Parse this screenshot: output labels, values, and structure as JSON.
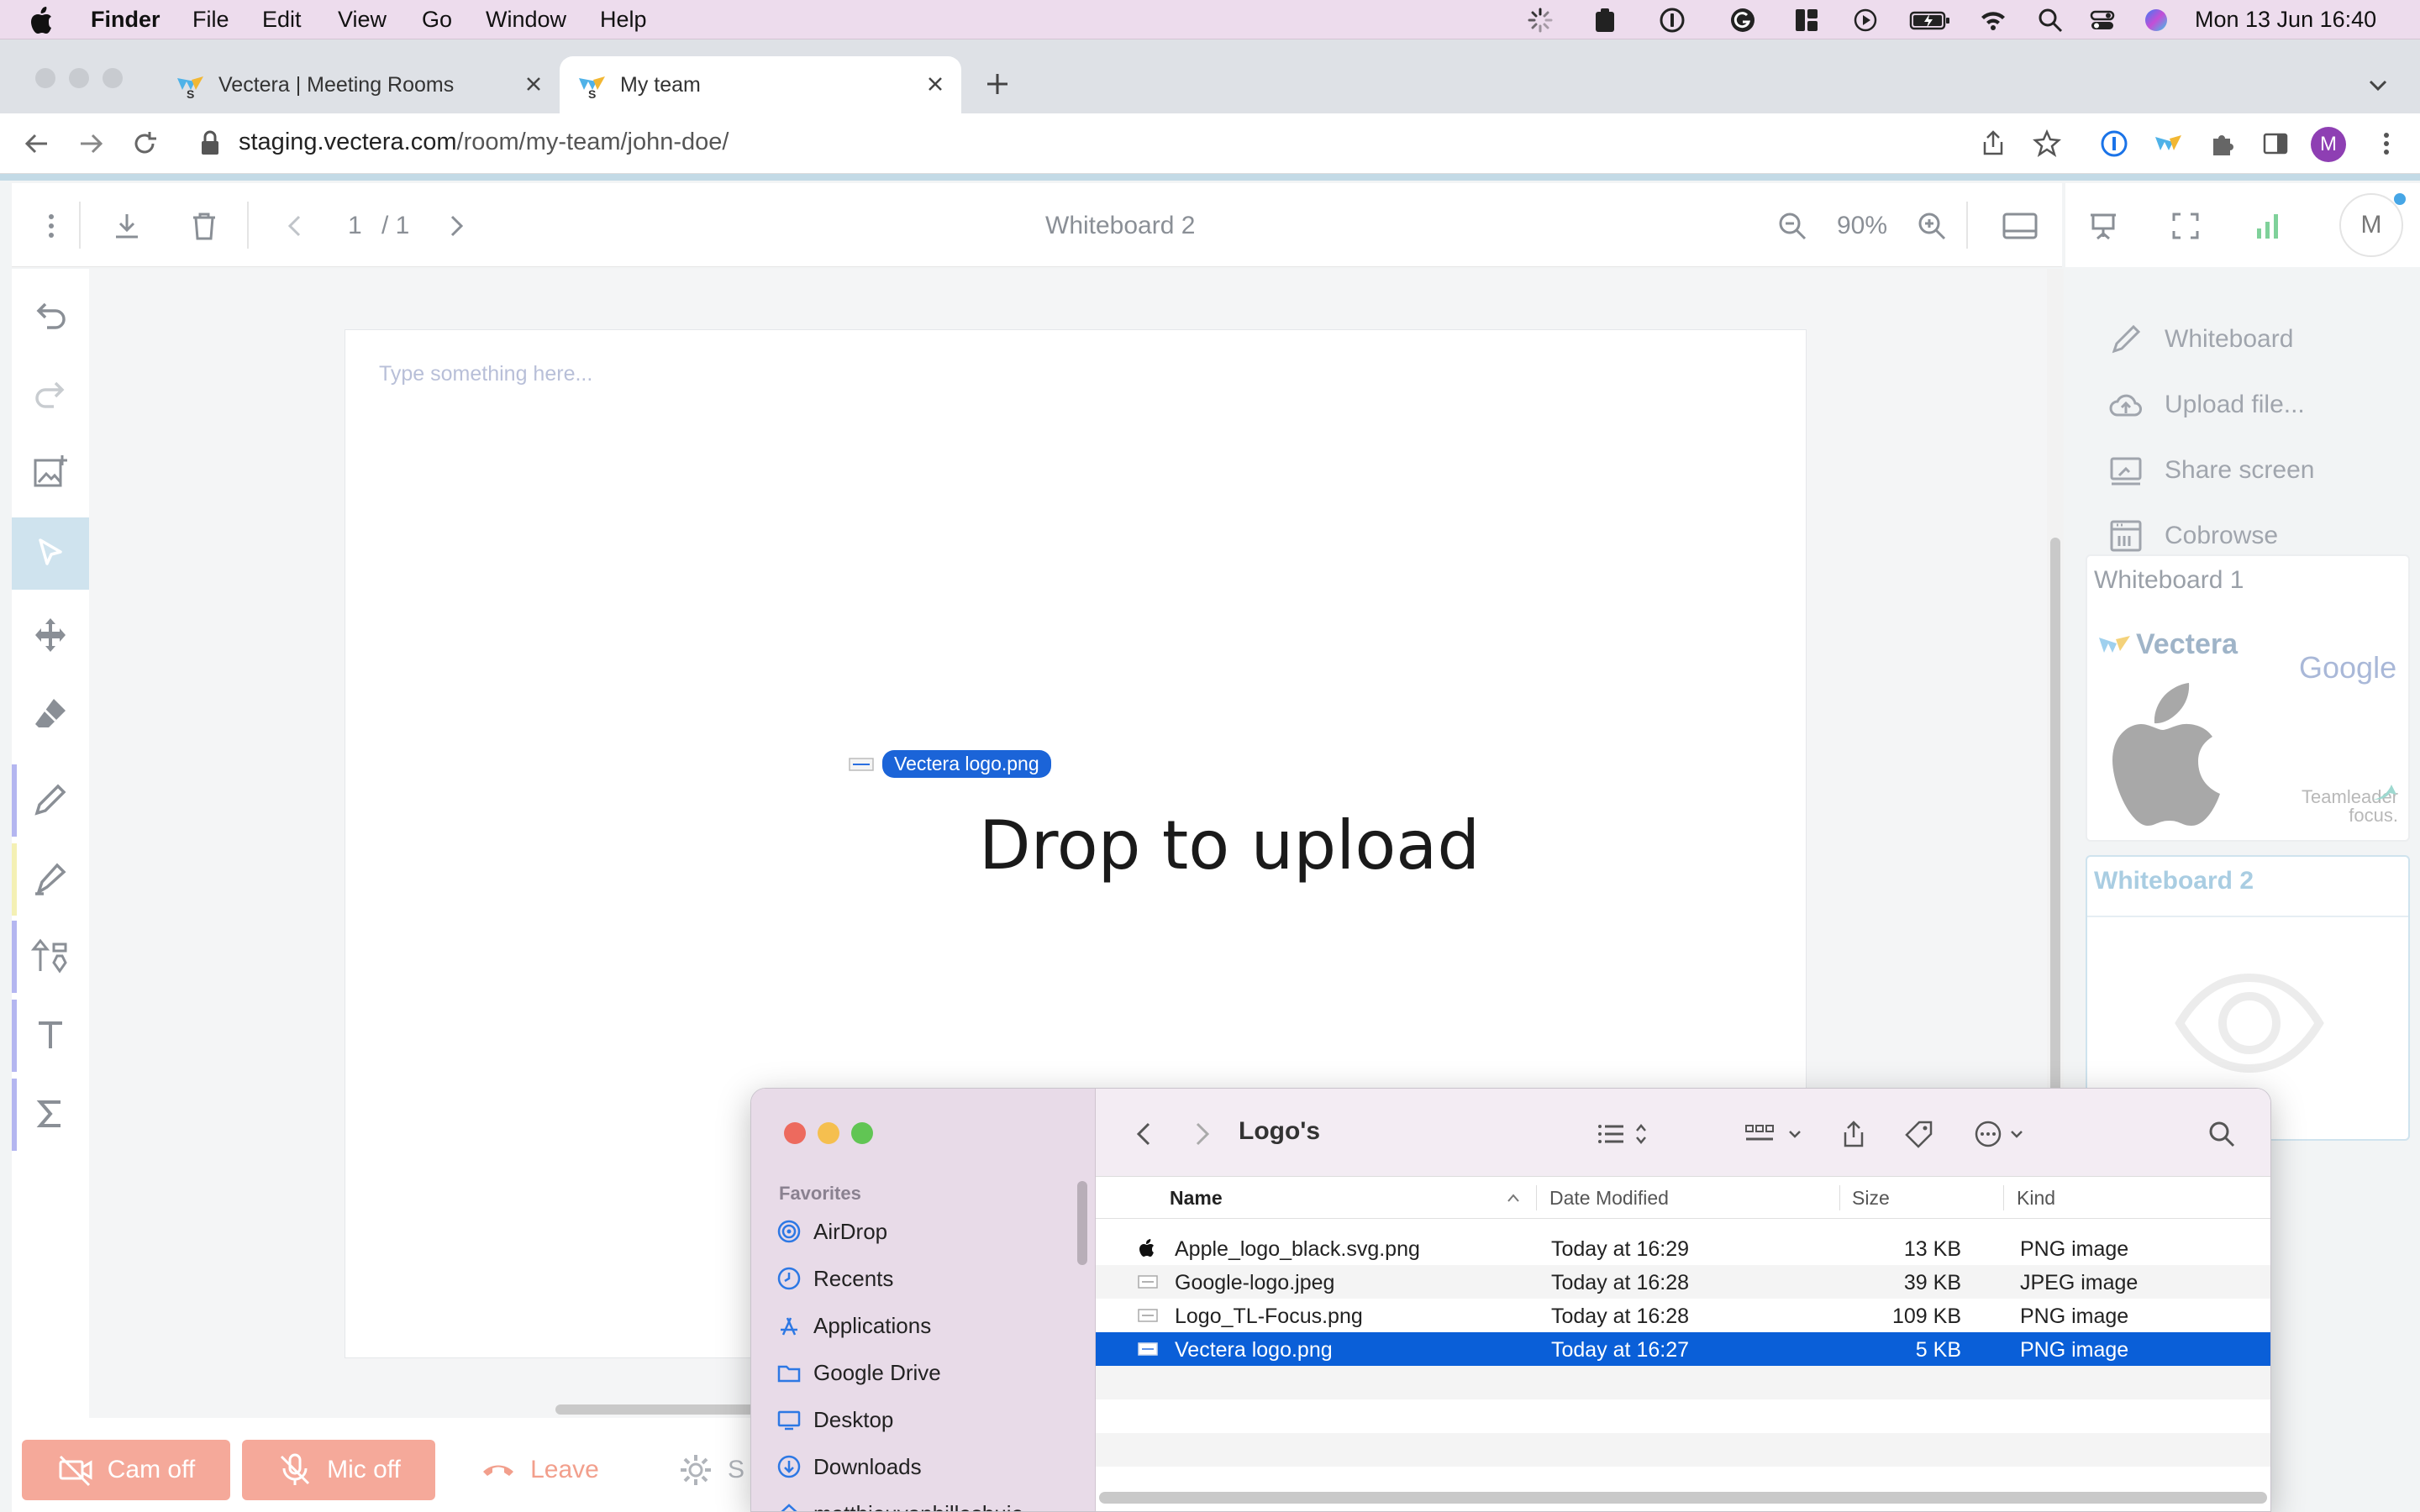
{
  "menubar": {
    "apple_icon": "apple-icon",
    "app_name": "Finder",
    "items": [
      "File",
      "Edit",
      "View",
      "Go",
      "Window",
      "Help"
    ],
    "status_icons": [
      "loading-spinner-icon",
      "clipboard-icon",
      "1password-icon",
      "grammarly-icon",
      "layout-icon",
      "play-icon",
      "battery-icon",
      "wifi-icon",
      "search-icon",
      "control-center-icon",
      "siri-icon"
    ],
    "clock": "Mon 13 Jun  16:40"
  },
  "browser": {
    "tabs": [
      {
        "title": "Vectera | Meeting Rooms",
        "active": false
      },
      {
        "title": "My team",
        "active": true
      }
    ],
    "url_host": "staging.vectera.com",
    "url_path": "/room/my-team/john-doe/"
  },
  "toolbar": {
    "page_current": "1",
    "page_total": "/ 1",
    "document_title": "Whiteboard 2",
    "zoom": "90%"
  },
  "canvas": {
    "placeholder": "Type something here...",
    "drop_message": "Drop to upload",
    "drag_file_name": "Vectera logo.png"
  },
  "right_panel": {
    "avatar_initial": "M",
    "items": [
      {
        "label": "Whiteboard",
        "icon": "pencil-icon"
      },
      {
        "label": "Upload file...",
        "icon": "cloud-upload-icon"
      },
      {
        "label": "Share screen",
        "icon": "screen-share-icon"
      },
      {
        "label": "Cobrowse",
        "icon": "cobrowse-icon"
      }
    ],
    "whiteboards": [
      {
        "title": "Whiteboard 1",
        "thumb_texts": [
          "Vectera",
          "Google",
          "Teamleader",
          "focus."
        ]
      },
      {
        "title": "Whiteboard 2"
      }
    ]
  },
  "bottom_bar": {
    "cam_label": "Cam off",
    "mic_label": "Mic off",
    "leave_label": "Leave",
    "settings_label": "S"
  },
  "finder": {
    "folder_title": "Logo's",
    "favorites_label": "Favorites",
    "sidebar": [
      "AirDrop",
      "Recents",
      "Applications",
      "Google Drive",
      "Desktop",
      "Downloads",
      "matthieuvanhillesbuie"
    ],
    "columns": {
      "name": "Name",
      "date": "Date Modified",
      "size": "Size",
      "kind": "Kind"
    },
    "files": [
      {
        "name": "Apple_logo_black.svg.png",
        "date": "Today at 16:29",
        "size": "13 KB",
        "kind": "PNG image"
      },
      {
        "name": "Google-logo.jpeg",
        "date": "Today at 16:28",
        "size": "39 KB",
        "kind": "JPEG image"
      },
      {
        "name": "Logo_TL-Focus.png",
        "date": "Today at 16:28",
        "size": "109 KB",
        "kind": "PNG image"
      },
      {
        "name": "Vectera logo.png",
        "date": "Today at 16:27",
        "size": "5 KB",
        "kind": "PNG image"
      }
    ],
    "selected_file": "Vectera logo.png"
  },
  "colors": {
    "menubar_bg": "#eddced",
    "selection_blue": "#0a5fd8",
    "cam_button": "#f4a896",
    "mic_button": "#f4a896",
    "leave_red": "#f08e7a",
    "active_tool": "#cfe3ee",
    "drag_pill": "#1b64d8"
  }
}
